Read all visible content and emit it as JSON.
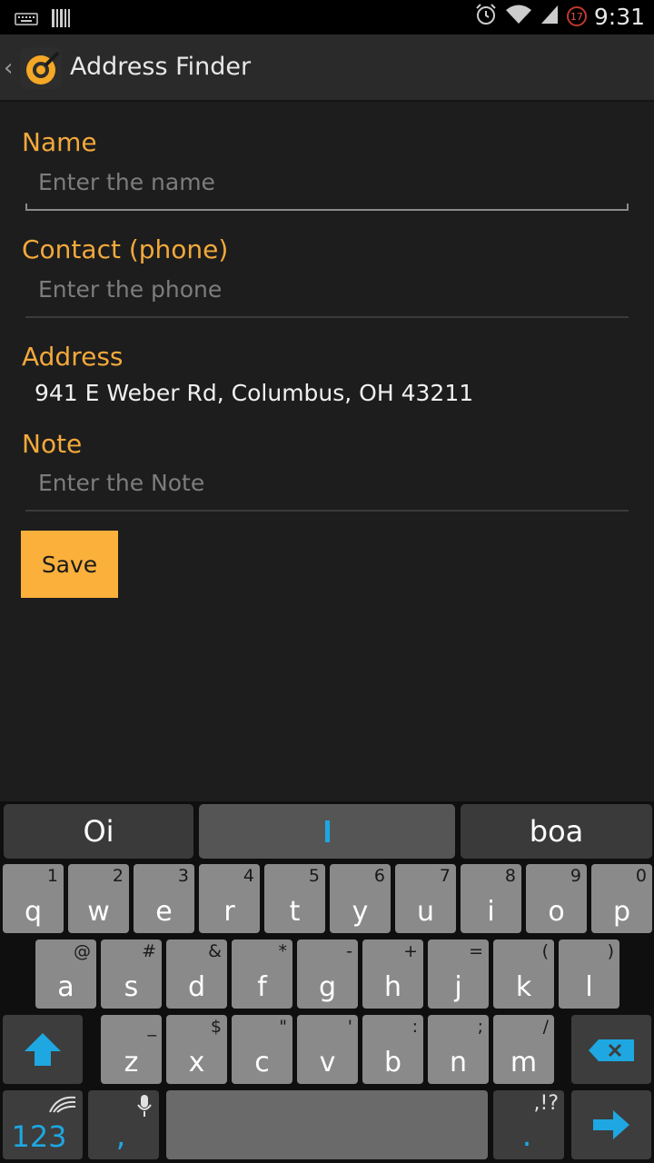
{
  "status_bar": {
    "time": "9:31",
    "notification_count": "17",
    "icons": [
      "keyboard-icon",
      "barcode-icon",
      "alarm-icon",
      "wifi-icon",
      "signal-icon"
    ]
  },
  "action_bar": {
    "title": "Address Finder",
    "logo_icon": "address-finder-logo-icon",
    "back_icon": "chevron-left-icon"
  },
  "form": {
    "name_label": "Name",
    "name_placeholder": "Enter the name",
    "name_value": "",
    "phone_label": "Contact (phone)",
    "phone_placeholder": "Enter the phone",
    "phone_value": "",
    "address_label": "Address",
    "address_value": "941 E Weber Rd, Columbus, OH 43211",
    "note_label": "Note",
    "note_placeholder": "Enter the Note",
    "note_value": "",
    "save_label": "Save"
  },
  "keyboard": {
    "suggestions": [
      "Oi",
      "",
      "boa"
    ],
    "row1": [
      {
        "key": "q",
        "alt": "1"
      },
      {
        "key": "w",
        "alt": "2"
      },
      {
        "key": "e",
        "alt": "3"
      },
      {
        "key": "r",
        "alt": "4"
      },
      {
        "key": "t",
        "alt": "5"
      },
      {
        "key": "y",
        "alt": "6"
      },
      {
        "key": "u",
        "alt": "7"
      },
      {
        "key": "i",
        "alt": "8"
      },
      {
        "key": "o",
        "alt": "9"
      },
      {
        "key": "p",
        "alt": "0"
      }
    ],
    "row2": [
      {
        "key": "a",
        "alt": "@"
      },
      {
        "key": "s",
        "alt": "#"
      },
      {
        "key": "d",
        "alt": "&"
      },
      {
        "key": "f",
        "alt": "*"
      },
      {
        "key": "g",
        "alt": "-"
      },
      {
        "key": "h",
        "alt": "+"
      },
      {
        "key": "j",
        "alt": "="
      },
      {
        "key": "k",
        "alt": "("
      },
      {
        "key": "l",
        "alt": ")"
      }
    ],
    "row3": [
      {
        "key": "z",
        "alt": "_"
      },
      {
        "key": "x",
        "alt": "$"
      },
      {
        "key": "c",
        "alt": "\""
      },
      {
        "key": "v",
        "alt": "'"
      },
      {
        "key": "b",
        "alt": ":"
      },
      {
        "key": "n",
        "alt": ";"
      },
      {
        "key": "m",
        "alt": "/"
      }
    ],
    "numbers_label": "123",
    "comma_label": ",",
    "period_label": ".",
    "punct_label": ",!?",
    "colors": {
      "accent": "#1ea7e1",
      "key": "#8a8a8a",
      "label": "#f2a93b",
      "button": "#fbb03b"
    }
  }
}
